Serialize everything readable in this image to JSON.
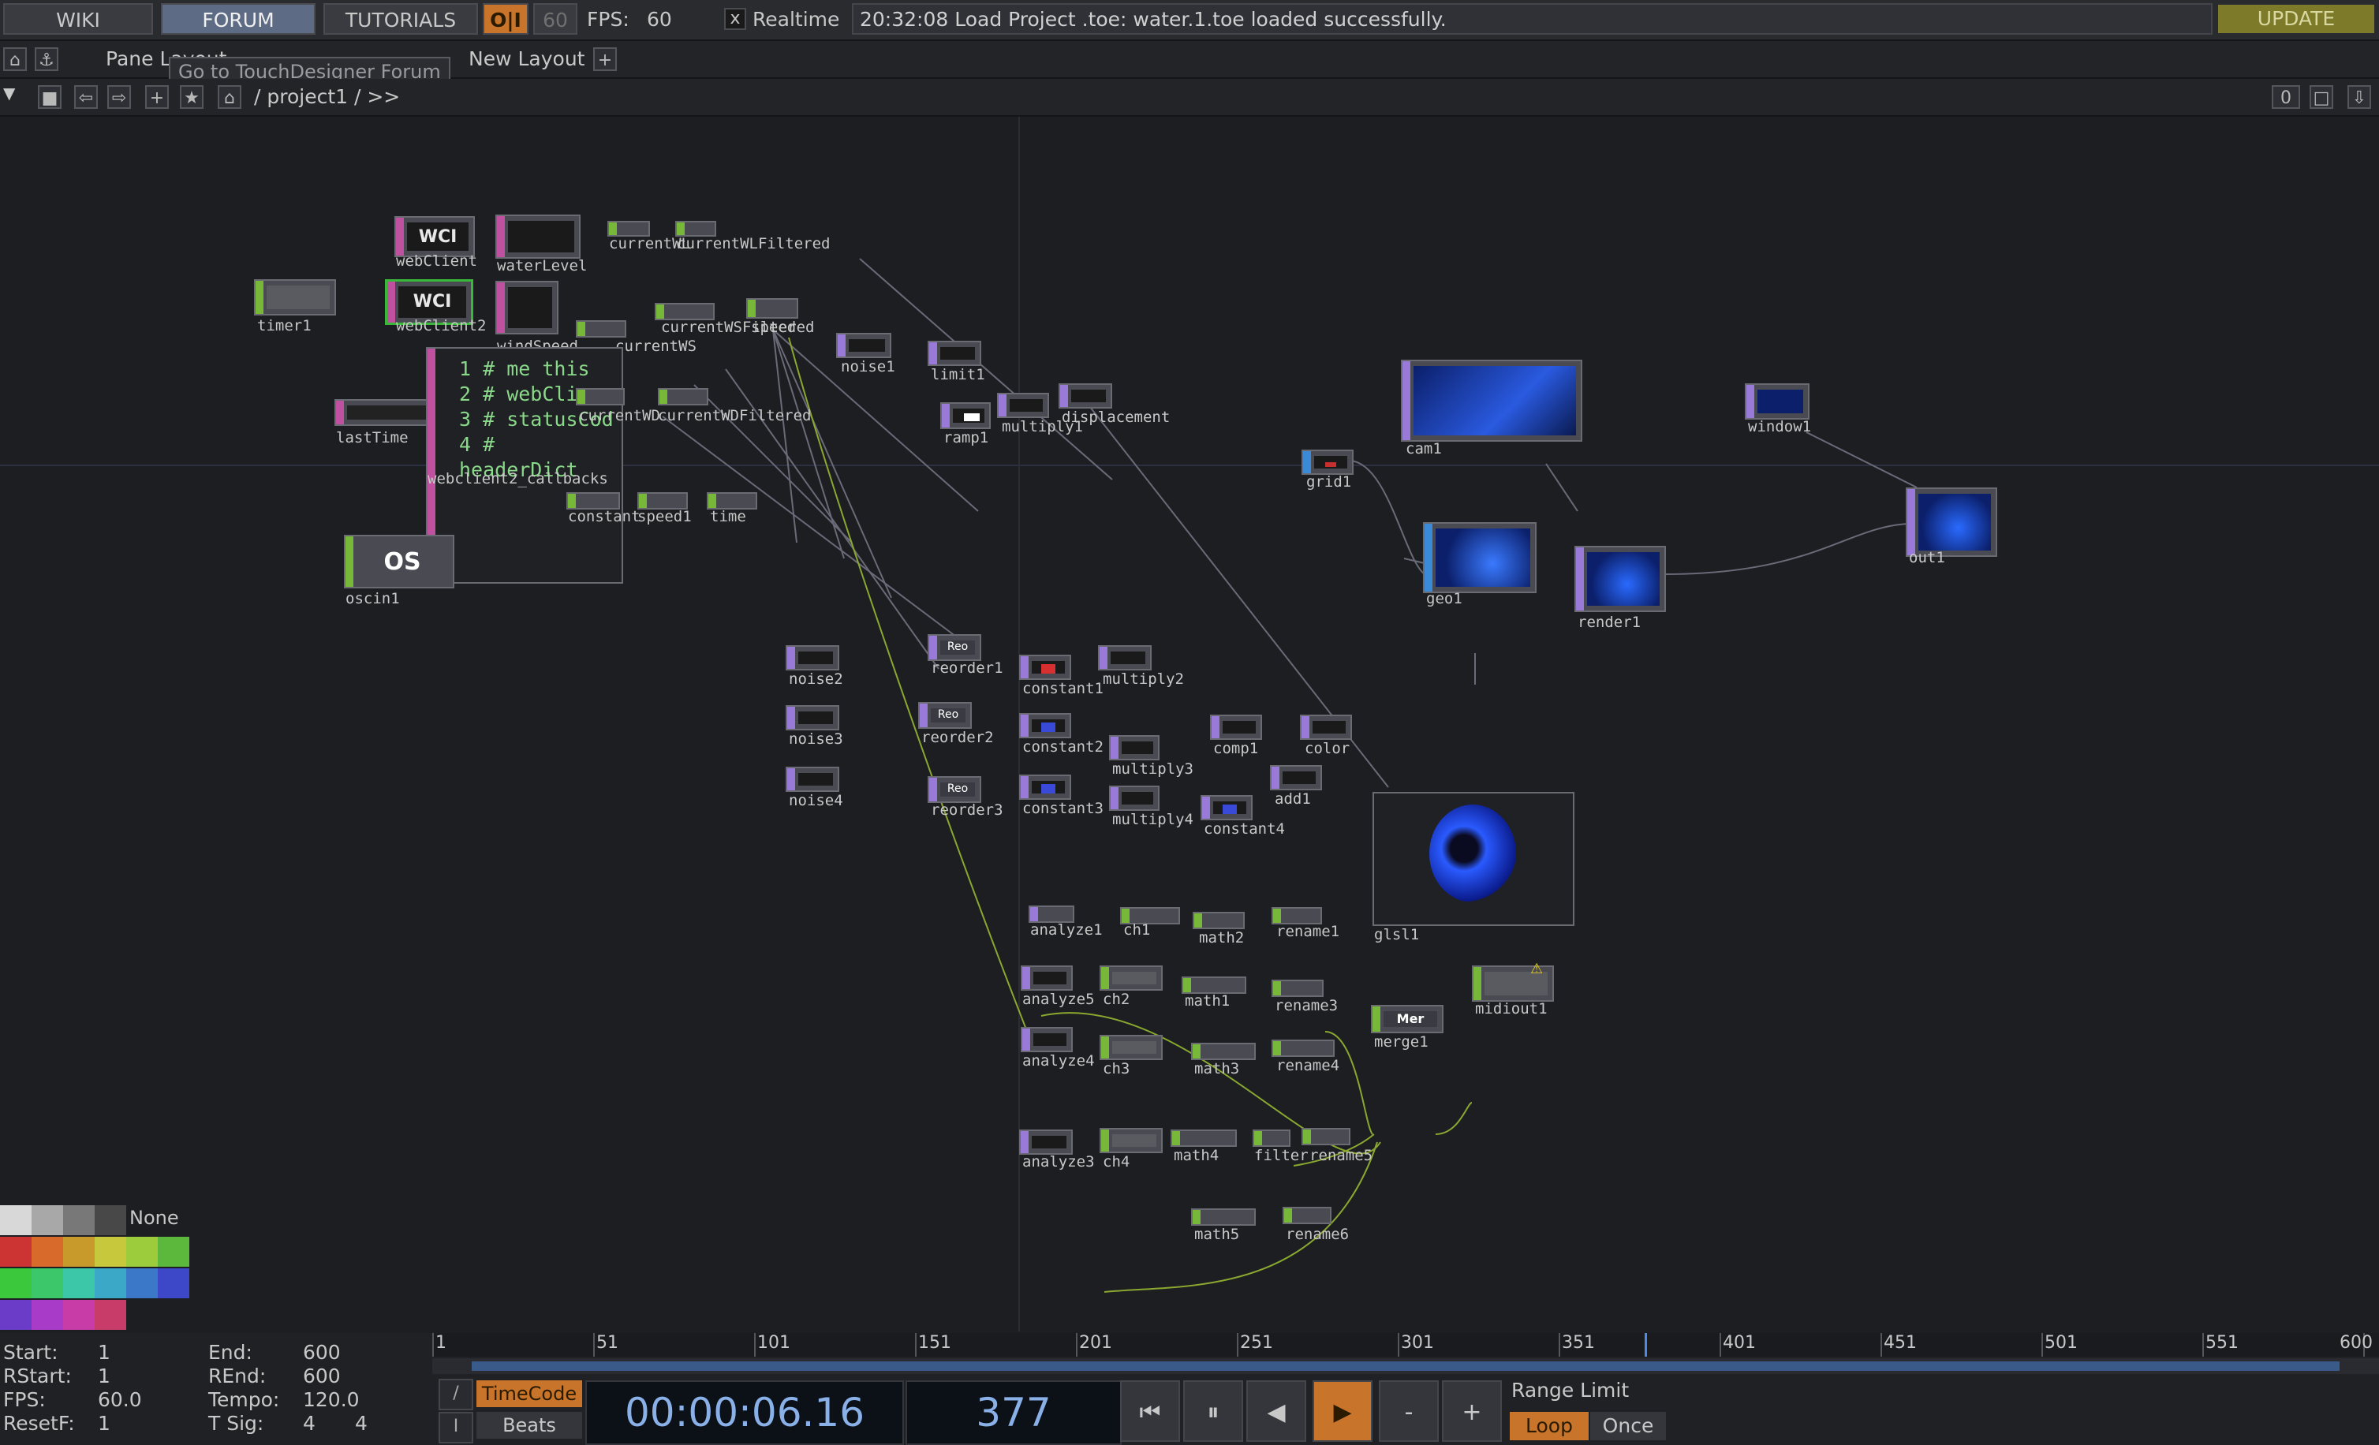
{
  "topbar": {
    "wiki": "WIKI",
    "forum": "FORUM",
    "tutorials": "TUTORIALS",
    "oi": "O|I",
    "fps_limit": "60",
    "fps_label": "FPS:",
    "fps_value": "60",
    "realtime_check": "x",
    "realtime_label": "Realtime",
    "status": "20:32:08 Load Project .toe: water.1.toe loaded successfully.",
    "update": "UPDATE"
  },
  "pane": {
    "layout_label": "Pane Layout",
    "tooltip": "Go to TouchDesigner Forum",
    "new_layout": "New Layout",
    "plus": "+"
  },
  "path": {
    "breadcrumb": "/ project1 / >>",
    "right_count": "0"
  },
  "nodes": {
    "webClient": "webClient",
    "waterLevel": "waterLevel",
    "currentWL": "currentWL",
    "currentWLFiltered": "currentWLFiltered",
    "webClient2": "webClient2",
    "timer1": "timer1",
    "windSpeed": "windSpeed",
    "currentWS": "currentWS",
    "currentWSFiltered": "currentWSFiltered",
    "speed": "speed",
    "noise1": "noise1",
    "limit1": "limit1",
    "lastTime": "lastTime",
    "currentWD": "currentWD",
    "currentWDFiltered": "currentWDFiltered",
    "multiply1": "multiply1",
    "displacement": "displacement",
    "ramp1": "ramp1",
    "callbacks": "webclient2_callbacks",
    "constant": "constant",
    "speed1": "speed1",
    "time": "time",
    "oscin1": "oscin1",
    "cam1": "cam1",
    "window1": "window1",
    "grid1": "grid1",
    "geo1": "geo1",
    "render1": "render1",
    "out1": "out1",
    "noise2": "noise2",
    "reorder1": "reorder1",
    "constant1": "constant1",
    "multiply2": "multiply2",
    "noise3": "noise3",
    "reorder2": "reorder2",
    "constant2": "constant2",
    "multiply3": "multiply3",
    "comp1": "comp1",
    "color": "color",
    "glsl1": "glsl1",
    "noise4": "noise4",
    "reorder3": "reorder3",
    "constant3": "constant3",
    "multiply4": "multiply4",
    "constant4": "constant4",
    "add1": "add1",
    "analyze1": "analyze1",
    "ch1": "ch1",
    "math2": "math2",
    "rename1": "rename1",
    "analyze5": "analyze5",
    "ch2": "ch2",
    "math1": "math1",
    "rename3": "rename3",
    "merge1": "merge1",
    "midiout1": "midiout1",
    "analyze4": "analyze4",
    "ch3": "ch3",
    "math3": "math3",
    "rename4": "rename4",
    "analyze3": "analyze3",
    "ch4": "ch4",
    "math4": "math4",
    "filter": "filter",
    "rename5": "rename5",
    "math5": "math5",
    "rename6": "rename6",
    "wci_badge": "WCI",
    "os_badge": "OS",
    "reo_badge": "Reo",
    "mer_badge": "Mer"
  },
  "code_lines": [
    "1 # me  this",
    "2 # webCli",
    "3 # statusCod",
    "4 # headerDict"
  ],
  "palette": {
    "none_label": "None",
    "colors": [
      "#d8d8d8",
      "#a8a8a8",
      "#787878",
      "#484848",
      "#cc3333",
      "#d86a2c",
      "#c89a2c",
      "#c8c83c",
      "#9ccc3c",
      "#5cb83c",
      "#3cc83c",
      "#3cc86a",
      "#3cc8a8",
      "#3ca8c8",
      "#3c78c8",
      "#3c48c8",
      "#6a3cc8",
      "#a83cc8",
      "#c83ca8",
      "#c83c6a"
    ]
  },
  "timeline": {
    "ticks": [
      "1",
      "51",
      "101",
      "151",
      "201",
      "251",
      "301",
      "351",
      "401",
      "451",
      "501",
      "551",
      "600"
    ],
    "current_frame_fraction": 0.628
  },
  "info": {
    "start_label": "Start:",
    "start": "1",
    "rstart_label": "RStart:",
    "rstart": "1",
    "fps_label": "FPS:",
    "fps": "60.0",
    "resetf_label": "ResetF:",
    "resetf": "1",
    "end_label": "End:",
    "end": "600",
    "rend_label": "REnd:",
    "rend": "600",
    "tempo_label": "Tempo:",
    "tempo": "120.0",
    "tsig_label": "T Sig:",
    "tsig_a": "4",
    "tsig_b": "4"
  },
  "transport": {
    "timecode_btn": "TimeCode",
    "beats_btn": "Beats",
    "timecode": "00:00:06.16",
    "frame": "377",
    "range_limit": "Range Limit",
    "loop": "Loop",
    "once": "Once",
    "minus": "-",
    "plus": "+"
  }
}
